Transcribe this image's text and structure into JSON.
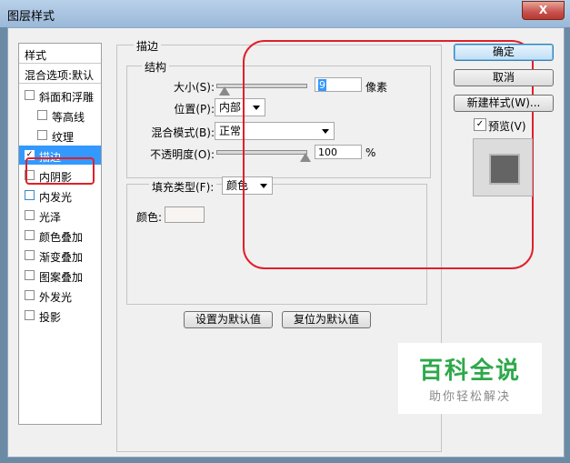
{
  "window": {
    "title": "图层样式",
    "close_label": "X"
  },
  "left_panel": {
    "header": "样式",
    "blend_options": "混合选项:默认",
    "items": [
      {
        "label": "斜面和浮雕",
        "checked": false
      },
      {
        "label": "等高线",
        "checked": false
      },
      {
        "label": "纹理",
        "checked": false
      },
      {
        "label": "描边",
        "checked": true
      },
      {
        "label": "内阴影",
        "checked": false
      },
      {
        "label": "内发光",
        "checked": false
      },
      {
        "label": "光泽",
        "checked": false
      },
      {
        "label": "颜色叠加",
        "checked": false
      },
      {
        "label": "渐变叠加",
        "checked": false
      },
      {
        "label": "图案叠加",
        "checked": false
      },
      {
        "label": "外发光",
        "checked": false
      },
      {
        "label": "投影",
        "checked": false
      }
    ],
    "check_mark": "✓"
  },
  "stroke": {
    "group_title": "描边",
    "structure_title": "结构",
    "size_label": "大小(S):",
    "size_value": "9",
    "size_unit": "像素",
    "size_level": 0.03,
    "position_label": "位置(P):",
    "position_value": "内部",
    "blend_label": "混合模式(B):",
    "blend_value": "正常",
    "opacity_label": "不透明度(O):",
    "opacity_value": "100",
    "opacity_unit": "%",
    "opacity_level": 1.0,
    "fill_type_label": "填充类型(F):",
    "fill_type_value": "颜色",
    "color_label": "颜色:",
    "color_swatch": "#f8f4f2"
  },
  "bottom_buttons": {
    "set_default": "设置为默认值",
    "reset_default": "复位为默认值"
  },
  "right_buttons": {
    "ok": "确定",
    "cancel": "取消",
    "new_style": "新建样式(W)...",
    "preview": "预览(V)",
    "preview_checked": true
  },
  "watermark": {
    "line1": "百科全说",
    "line2": "助你轻松解决"
  },
  "colors": {
    "accent_selected": "#3399ff",
    "annotation_red": "#e0202a",
    "watermark_green": "#2ea84a"
  }
}
